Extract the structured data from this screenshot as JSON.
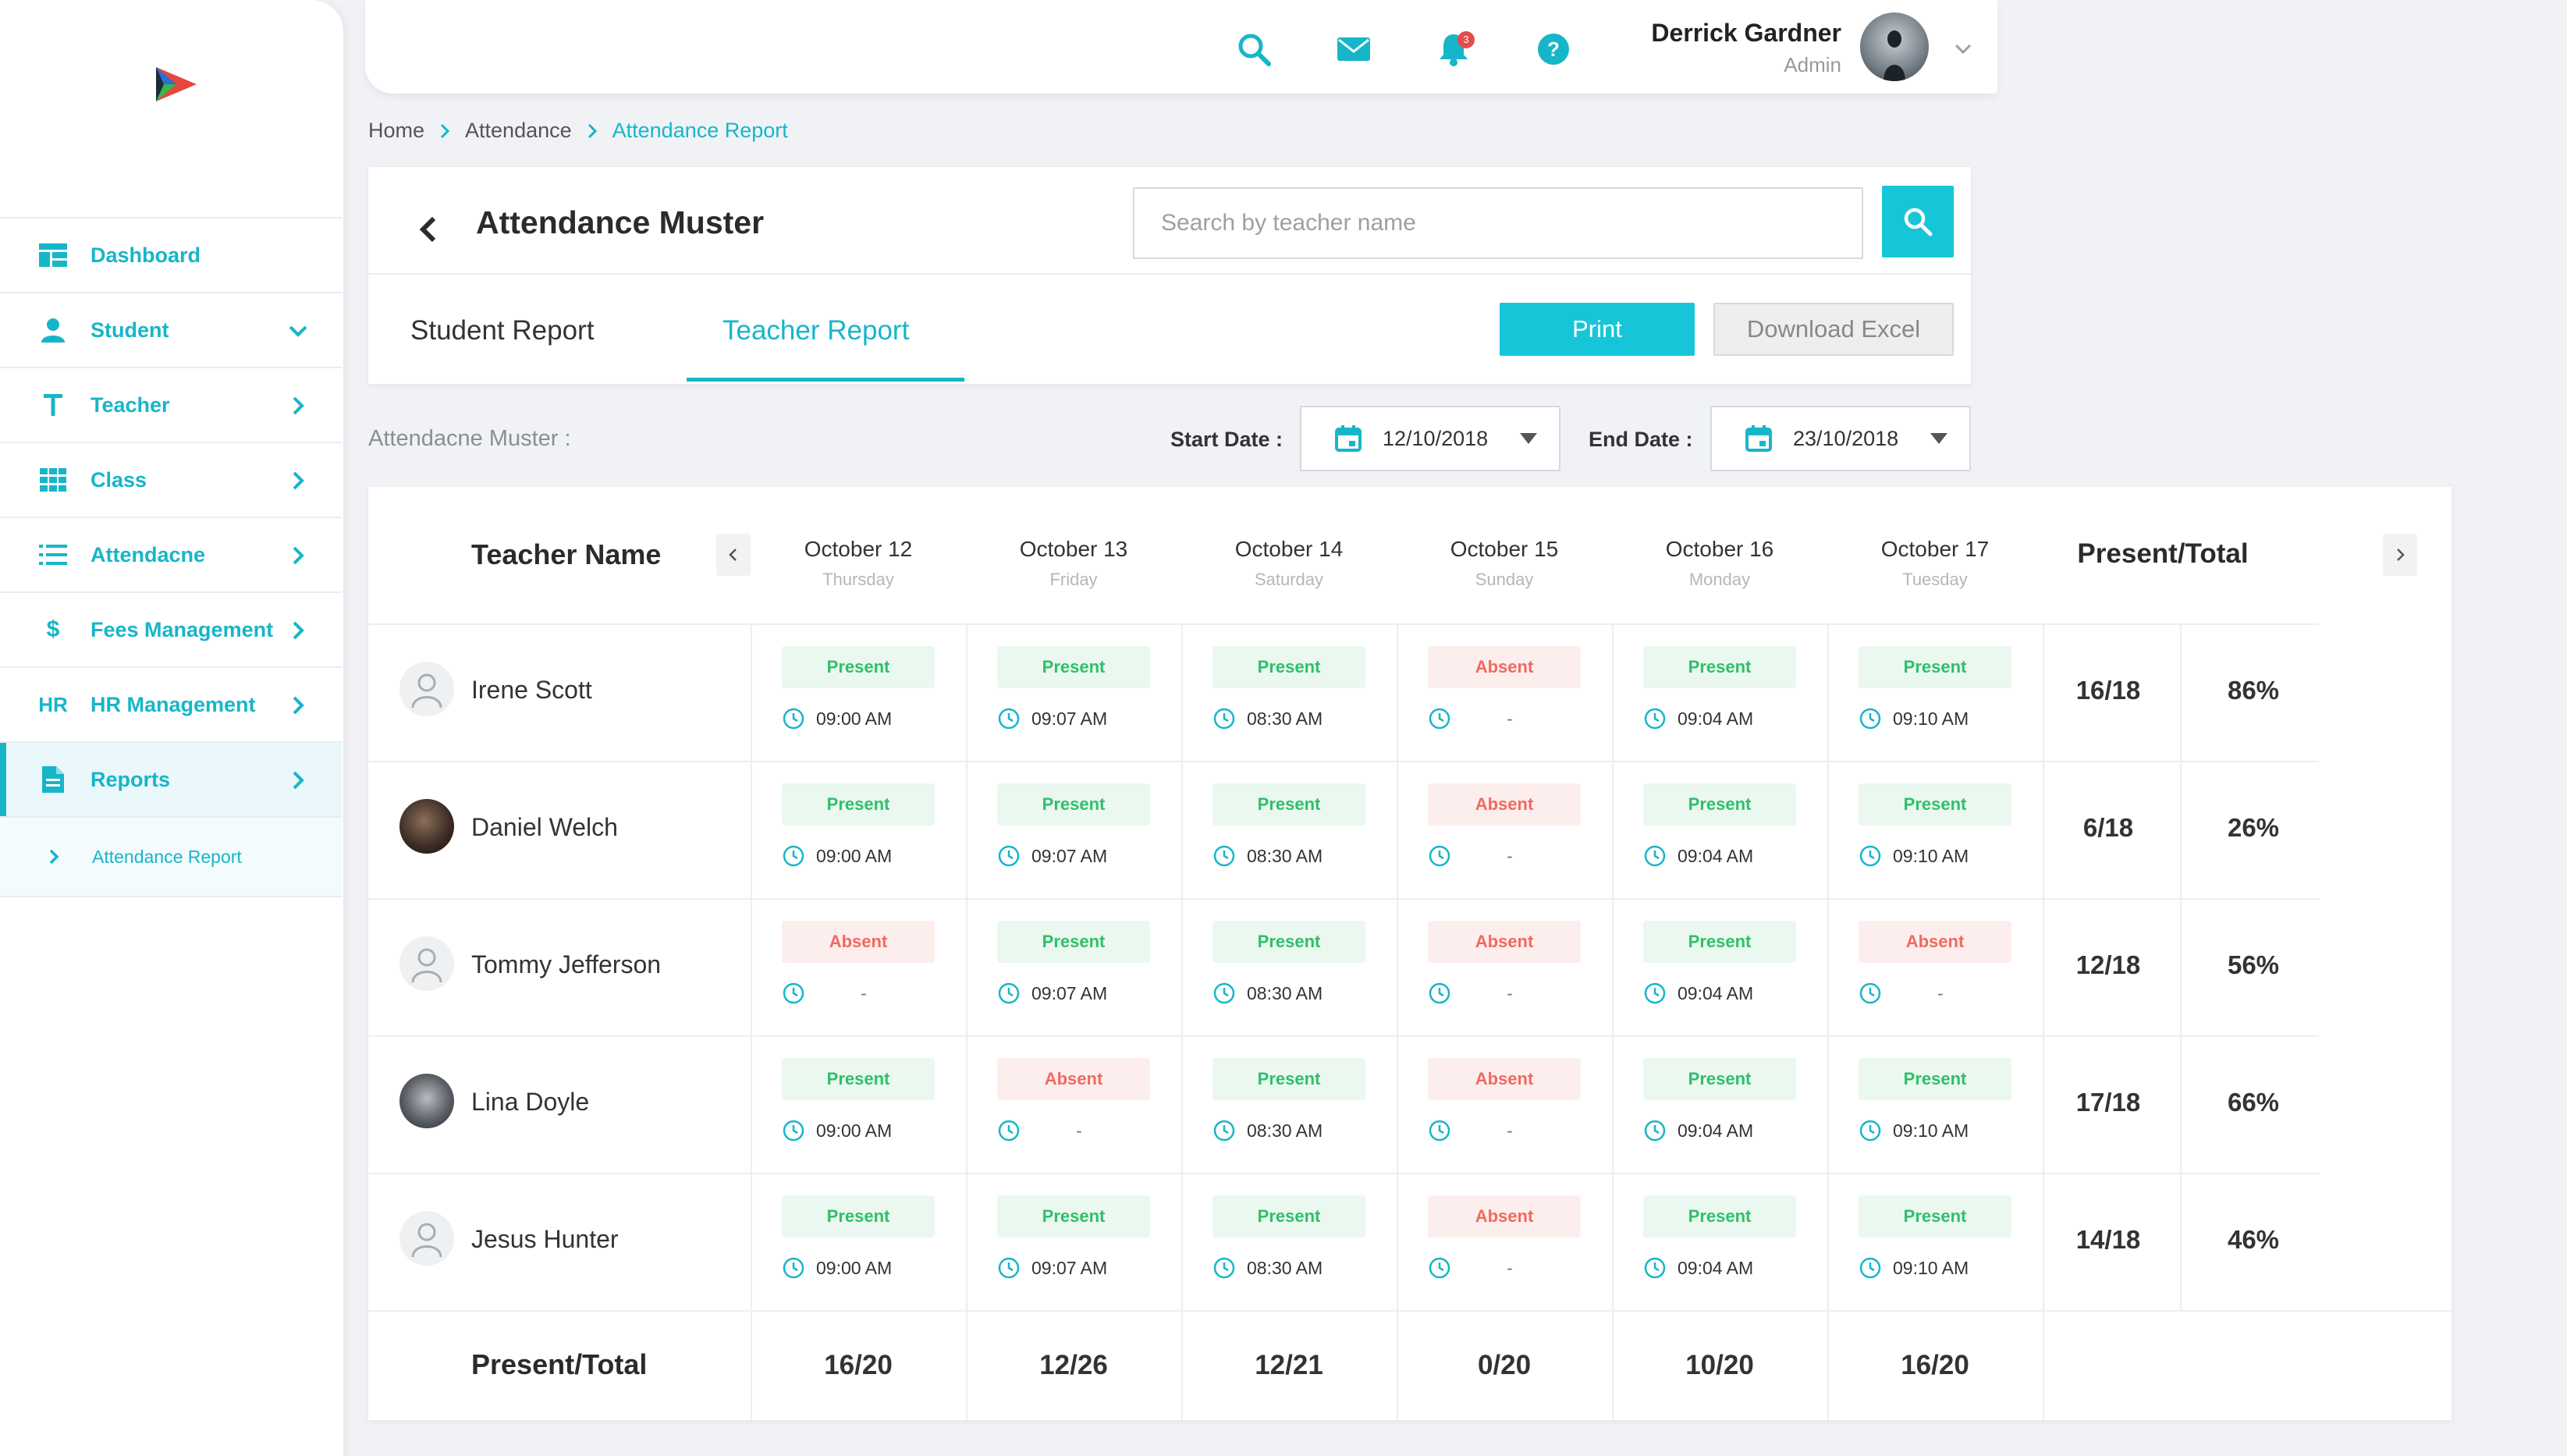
{
  "sidebar": {
    "items": [
      {
        "label": "Dashboard",
        "icon": "dashboard-icon"
      },
      {
        "label": "Student",
        "icon": "person-icon"
      },
      {
        "label": "Teacher",
        "icon": "letter-t-icon"
      },
      {
        "label": "Class",
        "icon": "grid-icon"
      },
      {
        "label": "Attendacne",
        "icon": "list-icon"
      },
      {
        "label": "Fees Management",
        "icon": "dollar-icon"
      },
      {
        "label": "HR Management",
        "icon": "hr-text-icon"
      },
      {
        "label": "Reports",
        "icon": "document-icon"
      }
    ],
    "sub_item": "Attendance Report",
    "accent": "#16b6c8"
  },
  "topbar": {
    "user_name": "Derrick Gardner",
    "user_role": "Admin",
    "notification_count": "3"
  },
  "breadcrumb": {
    "items": [
      "Home",
      "Attendance",
      "Attendance Report"
    ]
  },
  "header": {
    "title": "Attendance Muster",
    "search_placeholder": "Search by teacher name",
    "tabs": [
      "Student Report",
      "Teacher Report"
    ],
    "active_tab": "Teacher Report",
    "print_label": "Print",
    "excel_label": "Download Excel"
  },
  "filters": {
    "muster_label": "Attendacne Muster :",
    "start_label": "Start Date :",
    "start_value": "12/10/2018",
    "end_label": "End Date :",
    "end_value": "23/10/2018"
  },
  "table": {
    "name_header": "Teacher Name",
    "total_header": "Present/Total",
    "days": [
      {
        "date": "October 12",
        "weekday": "Thursday"
      },
      {
        "date": "October 13",
        "weekday": "Friday"
      },
      {
        "date": "October 14",
        "weekday": "Saturday"
      },
      {
        "date": "October 15",
        "weekday": "Sunday"
      },
      {
        "date": "October 16",
        "weekday": "Monday"
      },
      {
        "date": "October 17",
        "weekday": "Tuesday"
      }
    ],
    "rows": [
      {
        "name": "Irene Scott",
        "ratio": "16/18",
        "percent": "86%",
        "cells": [
          {
            "status": "Present",
            "time": "09:00 AM"
          },
          {
            "status": "Present",
            "time": "09:07 AM"
          },
          {
            "status": "Present",
            "time": "08:30 AM"
          },
          {
            "status": "Absent",
            "time": "-"
          },
          {
            "status": "Present",
            "time": "09:04 AM"
          },
          {
            "status": "Present",
            "time": "09:10 AM"
          }
        ]
      },
      {
        "name": "Daniel Welch",
        "ratio": "6/18",
        "percent": "26%",
        "cells": [
          {
            "status": "Present",
            "time": "09:00 AM"
          },
          {
            "status": "Present",
            "time": "09:07 AM"
          },
          {
            "status": "Present",
            "time": "08:30 AM"
          },
          {
            "status": "Absent",
            "time": "-"
          },
          {
            "status": "Present",
            "time": "09:04 AM"
          },
          {
            "status": "Present",
            "time": "09:10 AM"
          }
        ]
      },
      {
        "name": "Tommy Jefferson",
        "ratio": "12/18",
        "percent": "56%",
        "cells": [
          {
            "status": "Absent",
            "time": "-"
          },
          {
            "status": "Present",
            "time": "09:07 AM"
          },
          {
            "status": "Present",
            "time": "08:30 AM"
          },
          {
            "status": "Absent",
            "time": "-"
          },
          {
            "status": "Present",
            "time": "09:04 AM"
          },
          {
            "status": "Absent",
            "time": "-"
          }
        ]
      },
      {
        "name": "Lina Doyle",
        "ratio": "17/18",
        "percent": "66%",
        "cells": [
          {
            "status": "Present",
            "time": "09:00 AM"
          },
          {
            "status": "Absent",
            "time": "-"
          },
          {
            "status": "Present",
            "time": "08:30 AM"
          },
          {
            "status": "Absent",
            "time": "-"
          },
          {
            "status": "Present",
            "time": "09:04 AM"
          },
          {
            "status": "Present",
            "time": "09:10 AM"
          }
        ]
      },
      {
        "name": "Jesus Hunter",
        "ratio": "14/18",
        "percent": "46%",
        "cells": [
          {
            "status": "Present",
            "time": "09:00 AM"
          },
          {
            "status": "Present",
            "time": "09:07 AM"
          },
          {
            "status": "Present",
            "time": "08:30 AM"
          },
          {
            "status": "Absent",
            "time": "-"
          },
          {
            "status": "Present",
            "time": "09:04 AM"
          },
          {
            "status": "Present",
            "time": "09:10 AM"
          }
        ]
      }
    ],
    "footer_label": "Present/Total",
    "footer_values": [
      "16/20",
      "12/26",
      "12/21",
      "0/20",
      "10/20",
      "16/20"
    ]
  }
}
